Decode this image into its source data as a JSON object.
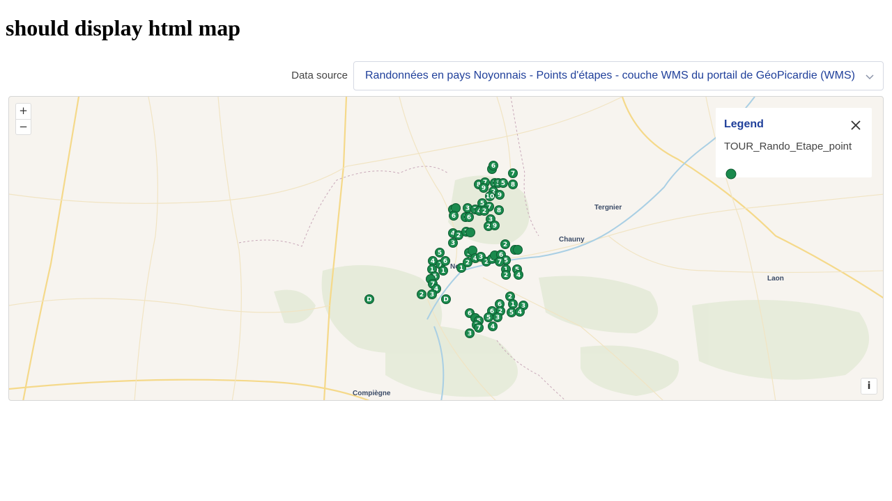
{
  "page": {
    "title": "should display html map"
  },
  "source": {
    "label": "Data source",
    "selected": "Randonnées en pays Noyonnais - Points d'étapes - couche WMS du portail de GéoPicardie (WMS)"
  },
  "map": {
    "zoom_in": "+",
    "zoom_out": "−",
    "info": "i",
    "places": [
      "Tergnier",
      "Chauny",
      "Laon",
      "Compiègne",
      "No"
    ],
    "marker_color": "#1a8a4d"
  },
  "legend": {
    "title": "Legend",
    "layer": "TOUR_Rando_Etape_point"
  }
}
